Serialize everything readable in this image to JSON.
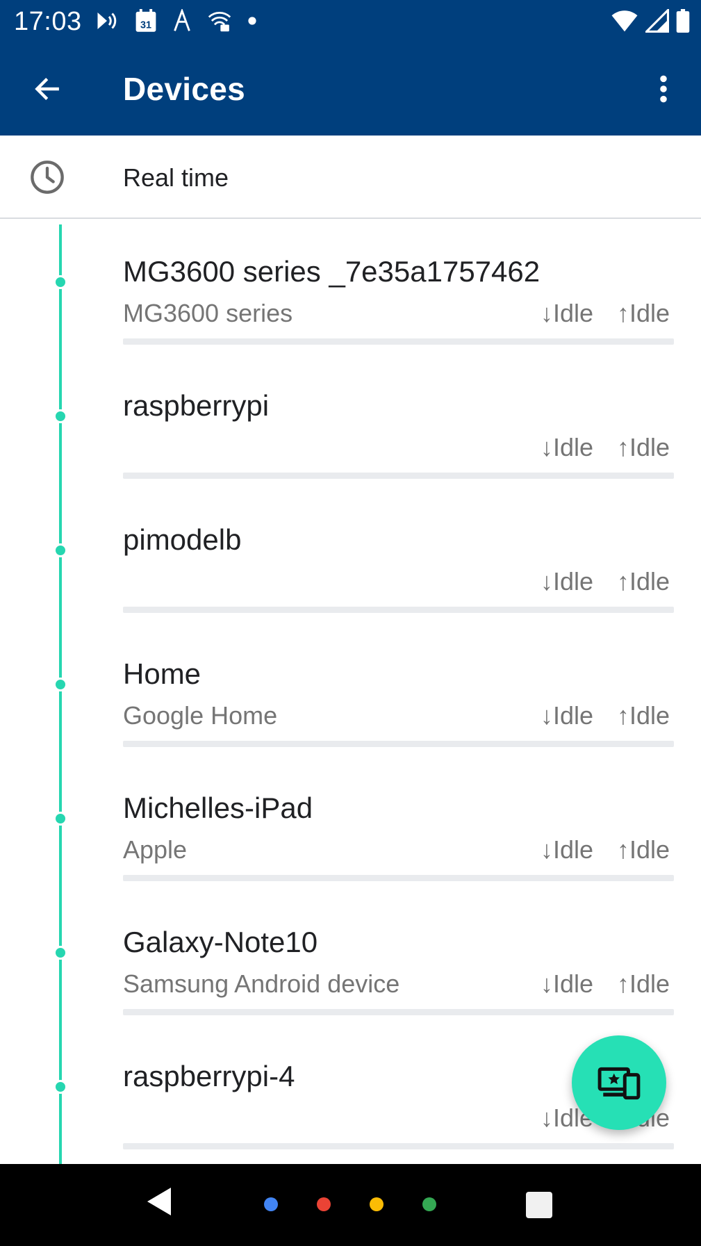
{
  "status_bar": {
    "time": "17:03",
    "left_icons": [
      "cast-icon",
      "calendar-icon",
      "network-activity-icon",
      "wifi-lock-icon",
      "dot-icon"
    ],
    "right_icons": [
      "wifi-icon",
      "signal-icon",
      "battery-icon"
    ],
    "calendar_day": "31"
  },
  "app_bar": {
    "title": "Devices",
    "back_icon": "arrow-back-icon",
    "menu_icon": "more-vert-icon"
  },
  "filter": {
    "label": "Real time",
    "icon": "clock-icon"
  },
  "devices": [
    {
      "name": "MG3600 series _7e35a1757462",
      "subtitle": "MG3600 series",
      "down": "↓Idle",
      "up": "↑Idle"
    },
    {
      "name": "raspberrypi",
      "subtitle": "",
      "down": "↓Idle",
      "up": "↑Idle"
    },
    {
      "name": "pimodelb",
      "subtitle": "",
      "down": "↓Idle",
      "up": "↑Idle"
    },
    {
      "name": "Home",
      "subtitle": "Google Home",
      "down": "↓Idle",
      "up": "↑Idle"
    },
    {
      "name": "Michelles-iPad",
      "subtitle": "Apple",
      "down": "↓Idle",
      "up": "↑Idle"
    },
    {
      "name": "Galaxy-Note10",
      "subtitle": "Samsung Android device",
      "down": "↓Idle",
      "up": "↑Idle"
    },
    {
      "name": "raspberrypi-4",
      "subtitle": "",
      "down": "↓Idle",
      "up": "↑Idle"
    }
  ],
  "fab": {
    "icon": "devices-star-icon"
  },
  "nav_bar": {
    "dot_colors": [
      "#4285f4",
      "#ea4335",
      "#fbbc05",
      "#34a853"
    ]
  },
  "colors": {
    "primary": "#003f7d",
    "accent": "#26d6b0",
    "fab": "#26e0b5"
  }
}
